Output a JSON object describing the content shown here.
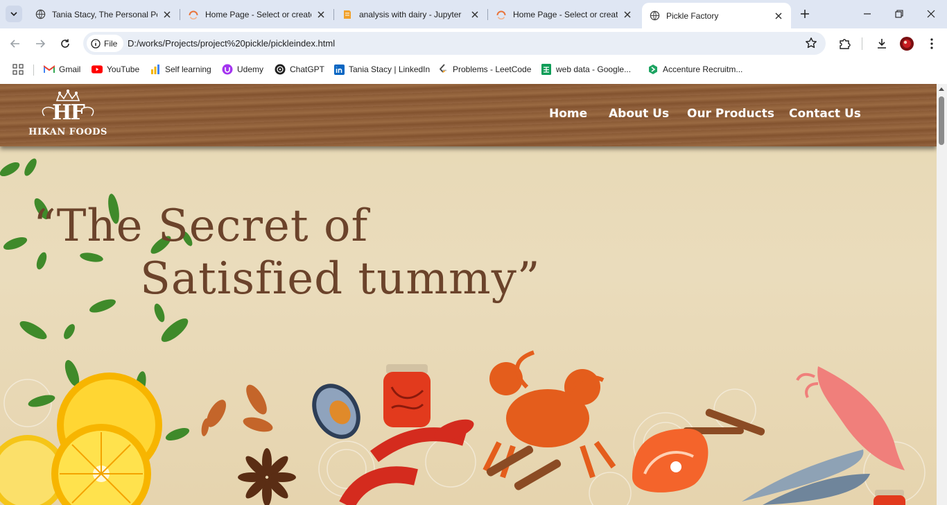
{
  "browser": {
    "tabs": [
      {
        "title": "Tania Stacy, The Personal Por",
        "icon": "globe-icon",
        "active": false
      },
      {
        "title": "Home Page - Select or create",
        "icon": "loading-ring-icon",
        "active": false
      },
      {
        "title": "analysis with dairy - Jupyter",
        "icon": "notebook-icon",
        "active": false
      },
      {
        "title": "Home Page - Select or create",
        "icon": "loading-ring-icon",
        "active": false
      },
      {
        "title": "Pickle Factory",
        "icon": "globe-icon",
        "active": true
      }
    ],
    "omnibox": {
      "chip_label": "File",
      "url": "D:/works/Projects/project%20pickle/pickleindex.html"
    },
    "bookmarks": [
      {
        "label": "Gmail",
        "icon": "gmail-icon"
      },
      {
        "label": "YouTube",
        "icon": "youtube-icon"
      },
      {
        "label": "Self learning",
        "icon": "bar-chart-icon"
      },
      {
        "label": "Udemy",
        "icon": "udemy-icon"
      },
      {
        "label": "ChatGPT",
        "icon": "chatgpt-icon"
      },
      {
        "label": "Tania Stacy | LinkedIn",
        "icon": "linkedin-icon"
      },
      {
        "label": "Problems - LeetCode",
        "icon": "leetcode-icon"
      },
      {
        "label": "web data - Google...",
        "icon": "sheets-icon"
      },
      {
        "label": "Accenture Recruitm...",
        "icon": "accenture-icon"
      }
    ]
  },
  "site": {
    "logo": {
      "monogram": "HF",
      "name": "HIKAN FOODS"
    },
    "nav": [
      "Home",
      "About Us",
      "Our Products",
      "Contact Us"
    ],
    "hero": {
      "line1": "“The Secret of",
      "line2": "Satisfied tummy”"
    }
  },
  "colors": {
    "header_wood": "#8a5a35",
    "page_background": "#e7d8b4",
    "quote_text": "#6b432b",
    "tabstrip": "#dfe6f3"
  }
}
